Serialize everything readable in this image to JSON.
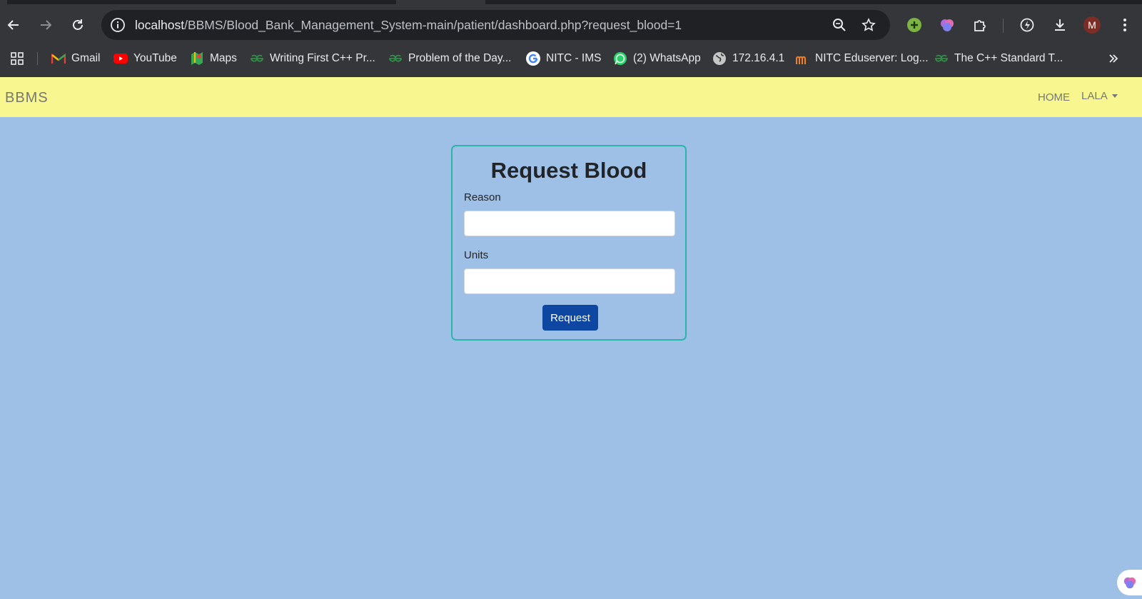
{
  "browser": {
    "url_host": "localhost",
    "url_path": "/BBMS/Blood_Bank_Management_System-main/patient/dashboard.php?request_blood=1",
    "avatar_letter": "M",
    "bookmarks": [
      {
        "label": "Gmail",
        "icon": "gmail-icon"
      },
      {
        "label": "YouTube",
        "icon": "youtube-icon"
      },
      {
        "label": "Maps",
        "icon": "maps-icon"
      },
      {
        "label": "Writing First C++ Pr...",
        "icon": "gfg-icon"
      },
      {
        "label": "Problem of the Day...",
        "icon": "gfg-icon"
      },
      {
        "label": "NITC - IMS",
        "icon": "google-icon"
      },
      {
        "label": "(2) WhatsApp",
        "icon": "whatsapp-icon"
      },
      {
        "label": "172.16.4.1",
        "icon": "globe-icon"
      },
      {
        "label": "NITC Eduserver: Log...",
        "icon": "moodle-icon"
      },
      {
        "label": "The C++ Standard T...",
        "icon": "gfg-icon"
      }
    ]
  },
  "navbar": {
    "brand": "BBMS",
    "home": "HOME",
    "user": "LALA"
  },
  "form": {
    "title": "Request Blood",
    "reason_label": "Reason",
    "reason_value": "",
    "units_label": "Units",
    "units_value": "",
    "submit_label": "Request"
  },
  "colors": {
    "page_bg": "#9fc0e6",
    "navbar_bg": "#f8f78f",
    "card_border": "#2bb5a7",
    "button_bg": "#0d47a1"
  }
}
